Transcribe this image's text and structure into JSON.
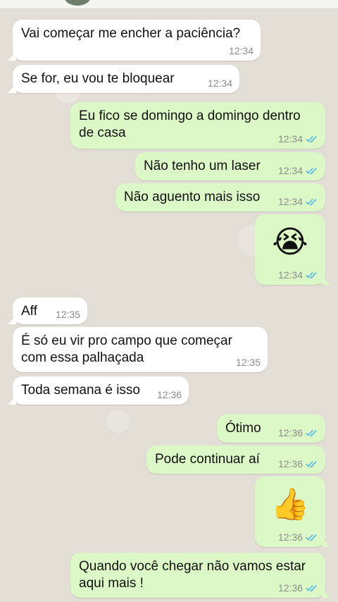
{
  "messages": [
    {
      "side": "in",
      "text": "Vai começar me encher a paciência?",
      "time": "12:34"
    },
    {
      "side": "in",
      "text": "Se for, eu vou te bloquear",
      "time": "12:34"
    },
    {
      "side": "out",
      "text": "Eu fico se domingo a domingo dentro",
      "text2": "de casa",
      "time": "12:34",
      "status": "read"
    },
    {
      "side": "out",
      "text": "Não tenho um laser",
      "time": "12:34",
      "status": "read"
    },
    {
      "side": "out",
      "text": "Não aguento mais isso",
      "time": "12:34",
      "status": "read"
    },
    {
      "side": "out",
      "emoji": "😭",
      "time": "12:34",
      "status": "read"
    },
    {
      "side": "in",
      "text": "Aff",
      "time": "12:35"
    },
    {
      "side": "in",
      "text": "É só eu vir pro campo que começar",
      "text2": "com essa palhaçada",
      "time": "12:35"
    },
    {
      "side": "in",
      "text": "Toda semana é isso",
      "time": "12:36"
    },
    {
      "side": "out",
      "text": "Ótimo",
      "time": "12:36",
      "status": "read"
    },
    {
      "side": "out",
      "text": "Pode continuar aí",
      "time": "12:36",
      "status": "read"
    },
    {
      "side": "out",
      "emoji": "👍",
      "time": "12:36",
      "status": "read"
    },
    {
      "side": "out",
      "text": "Quando você chegar não vamos estar",
      "text2": "aqui mais !",
      "time": "12:36",
      "status": "read"
    }
  ],
  "colors": {
    "incoming": "#ffffff",
    "outgoing": "#dcf8c6",
    "read_ticks": "#4fb6ec",
    "time": "#8b8b8b"
  }
}
